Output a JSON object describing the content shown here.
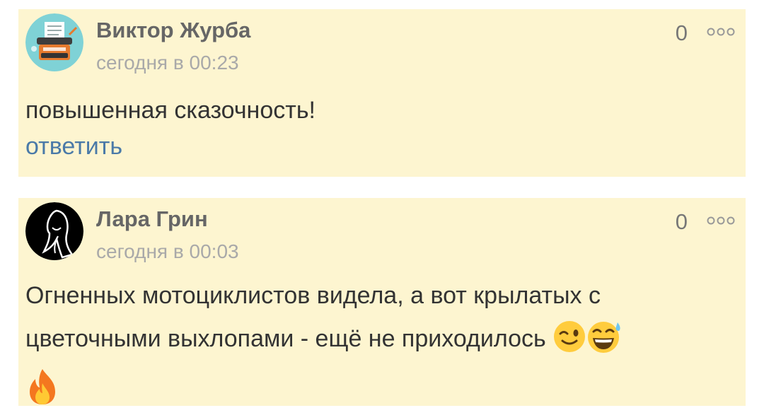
{
  "comments": [
    {
      "author": "Виктор Журба",
      "time": "сегодня в 00:23",
      "rating": "0",
      "text": "повышенная сказочность!",
      "reply_label": "ответить",
      "avatar_icon": "typewriter-avatar"
    },
    {
      "author": "Лара Грин",
      "time": "сегодня в 00:03",
      "rating": "0",
      "text": "Огненных мотоциклистов видела, а вот крылатых с цветочными выхлопами - ещё не приходилось",
      "emojis": [
        "wink-emoji",
        "sweat-grin-emoji",
        "fire-emoji"
      ],
      "avatar_icon": "silhouette-avatar"
    }
  ],
  "more_icon": "more-dots-icon",
  "colors": {
    "card_bg": "#fdf5d0",
    "author": "#666666",
    "meta": "#a9a9a9",
    "link": "#4a7aa8"
  }
}
